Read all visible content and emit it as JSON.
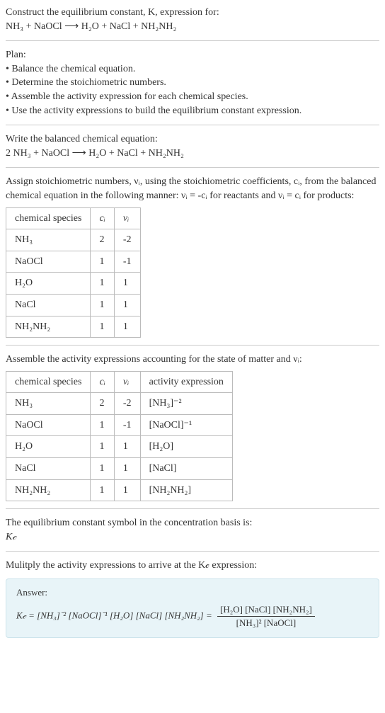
{
  "header": {
    "prompt": "Construct the equilibrium constant, K, expression for:",
    "equation": "NH₃ + NaOCl  ⟶  H₂O + NaCl + NH₂NH₂"
  },
  "plan": {
    "title": "Plan:",
    "items": [
      "• Balance the chemical equation.",
      "• Determine the stoichiometric numbers.",
      "• Assemble the activity expression for each chemical species.",
      "• Use the activity expressions to build the equilibrium constant expression."
    ]
  },
  "balanced": {
    "title": "Write the balanced chemical equation:",
    "equation": "2 NH₃ + NaOCl  ⟶  H₂O + NaCl + NH₂NH₂"
  },
  "assign": {
    "text": "Assign stoichiometric numbers, νᵢ, using the stoichiometric coefficients, cᵢ, from the balanced chemical equation in the following manner: νᵢ = -cᵢ for reactants and νᵢ = cᵢ for products:",
    "headers": [
      "chemical species",
      "cᵢ",
      "νᵢ"
    ],
    "rows": [
      {
        "species": "NH₃",
        "c": "2",
        "v": "-2"
      },
      {
        "species": "NaOCl",
        "c": "1",
        "v": "-1"
      },
      {
        "species": "H₂O",
        "c": "1",
        "v": "1"
      },
      {
        "species": "NaCl",
        "c": "1",
        "v": "1"
      },
      {
        "species": "NH₂NH₂",
        "c": "1",
        "v": "1"
      }
    ]
  },
  "assemble": {
    "text": "Assemble the activity expressions accounting for the state of matter and νᵢ:",
    "headers": [
      "chemical species",
      "cᵢ",
      "νᵢ",
      "activity expression"
    ],
    "rows": [
      {
        "species": "NH₃",
        "c": "2",
        "v": "-2",
        "act": "[NH₃]⁻²"
      },
      {
        "species": "NaOCl",
        "c": "1",
        "v": "-1",
        "act": "[NaOCl]⁻¹"
      },
      {
        "species": "H₂O",
        "c": "1",
        "v": "1",
        "act": "[H₂O]"
      },
      {
        "species": "NaCl",
        "c": "1",
        "v": "1",
        "act": "[NaCl]"
      },
      {
        "species": "NH₂NH₂",
        "c": "1",
        "v": "1",
        "act": "[NH₂NH₂]"
      }
    ]
  },
  "symbol": {
    "text": "The equilibrium constant symbol in the concentration basis is:",
    "sym": "K𝒸"
  },
  "multiply": {
    "text": "Mulitply the activity expressions to arrive at the K𝒸 expression:"
  },
  "answer": {
    "label": "Answer:",
    "lhs": "K𝒸 = [NH₃]⁻² [NaOCl]⁻¹ [H₂O] [NaCl] [NH₂NH₂] = ",
    "num": "[H₂O] [NaCl] [NH₂NH₂]",
    "den": "[NH₃]² [NaOCl]"
  }
}
